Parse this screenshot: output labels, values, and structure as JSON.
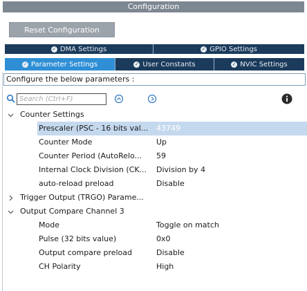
{
  "window": {
    "title": "Configuration"
  },
  "reset_button": {
    "label": "Reset Configuration"
  },
  "tabs": {
    "row1": [
      {
        "label": "DMA Settings",
        "icon": "check-circle-icon"
      },
      {
        "label": "GPIO Settings",
        "icon": "check-circle-icon"
      }
    ],
    "row2": [
      {
        "label": "Parameter Settings",
        "icon": "check-circle-icon",
        "active": true
      },
      {
        "label": "User Constants",
        "icon": "check-circle-icon"
      },
      {
        "label": "NVIC Settings",
        "icon": "check-circle-icon"
      }
    ]
  },
  "hint": "Configure the below parameters :",
  "search": {
    "placeholder": "Search (Ctrl+F)"
  },
  "tree": {
    "counter_settings": {
      "label": "Counter Settings",
      "items": [
        {
          "name": "Prescaler (PSC - 16 bits val...",
          "value": "43749"
        },
        {
          "name": "Counter Mode",
          "value": "Up"
        },
        {
          "name": "Counter Period (AutoRelo...",
          "value": "59"
        },
        {
          "name": "Internal Clock Division (CK...",
          "value": "Division by 4"
        },
        {
          "name": "auto-reload preload",
          "value": "Disable"
        }
      ]
    },
    "trigger_output": {
      "label": "Trigger Output (TRGO) Parame..."
    },
    "output_compare": {
      "label": "Output Compare Channel 3",
      "items": [
        {
          "name": "Mode",
          "value": "Toggle on match"
        },
        {
          "name": "Pulse (32 bits value)",
          "value": "0x0"
        },
        {
          "name": "Output compare preload",
          "value": "Disable"
        },
        {
          "name": "CH Polarity",
          "value": "High"
        }
      ]
    }
  },
  "colors": {
    "tab_bg": "#1b3b5c",
    "tab_active": "#2f8fd6",
    "selection": "#c5d9ee",
    "title_bar": "#7d8791"
  }
}
